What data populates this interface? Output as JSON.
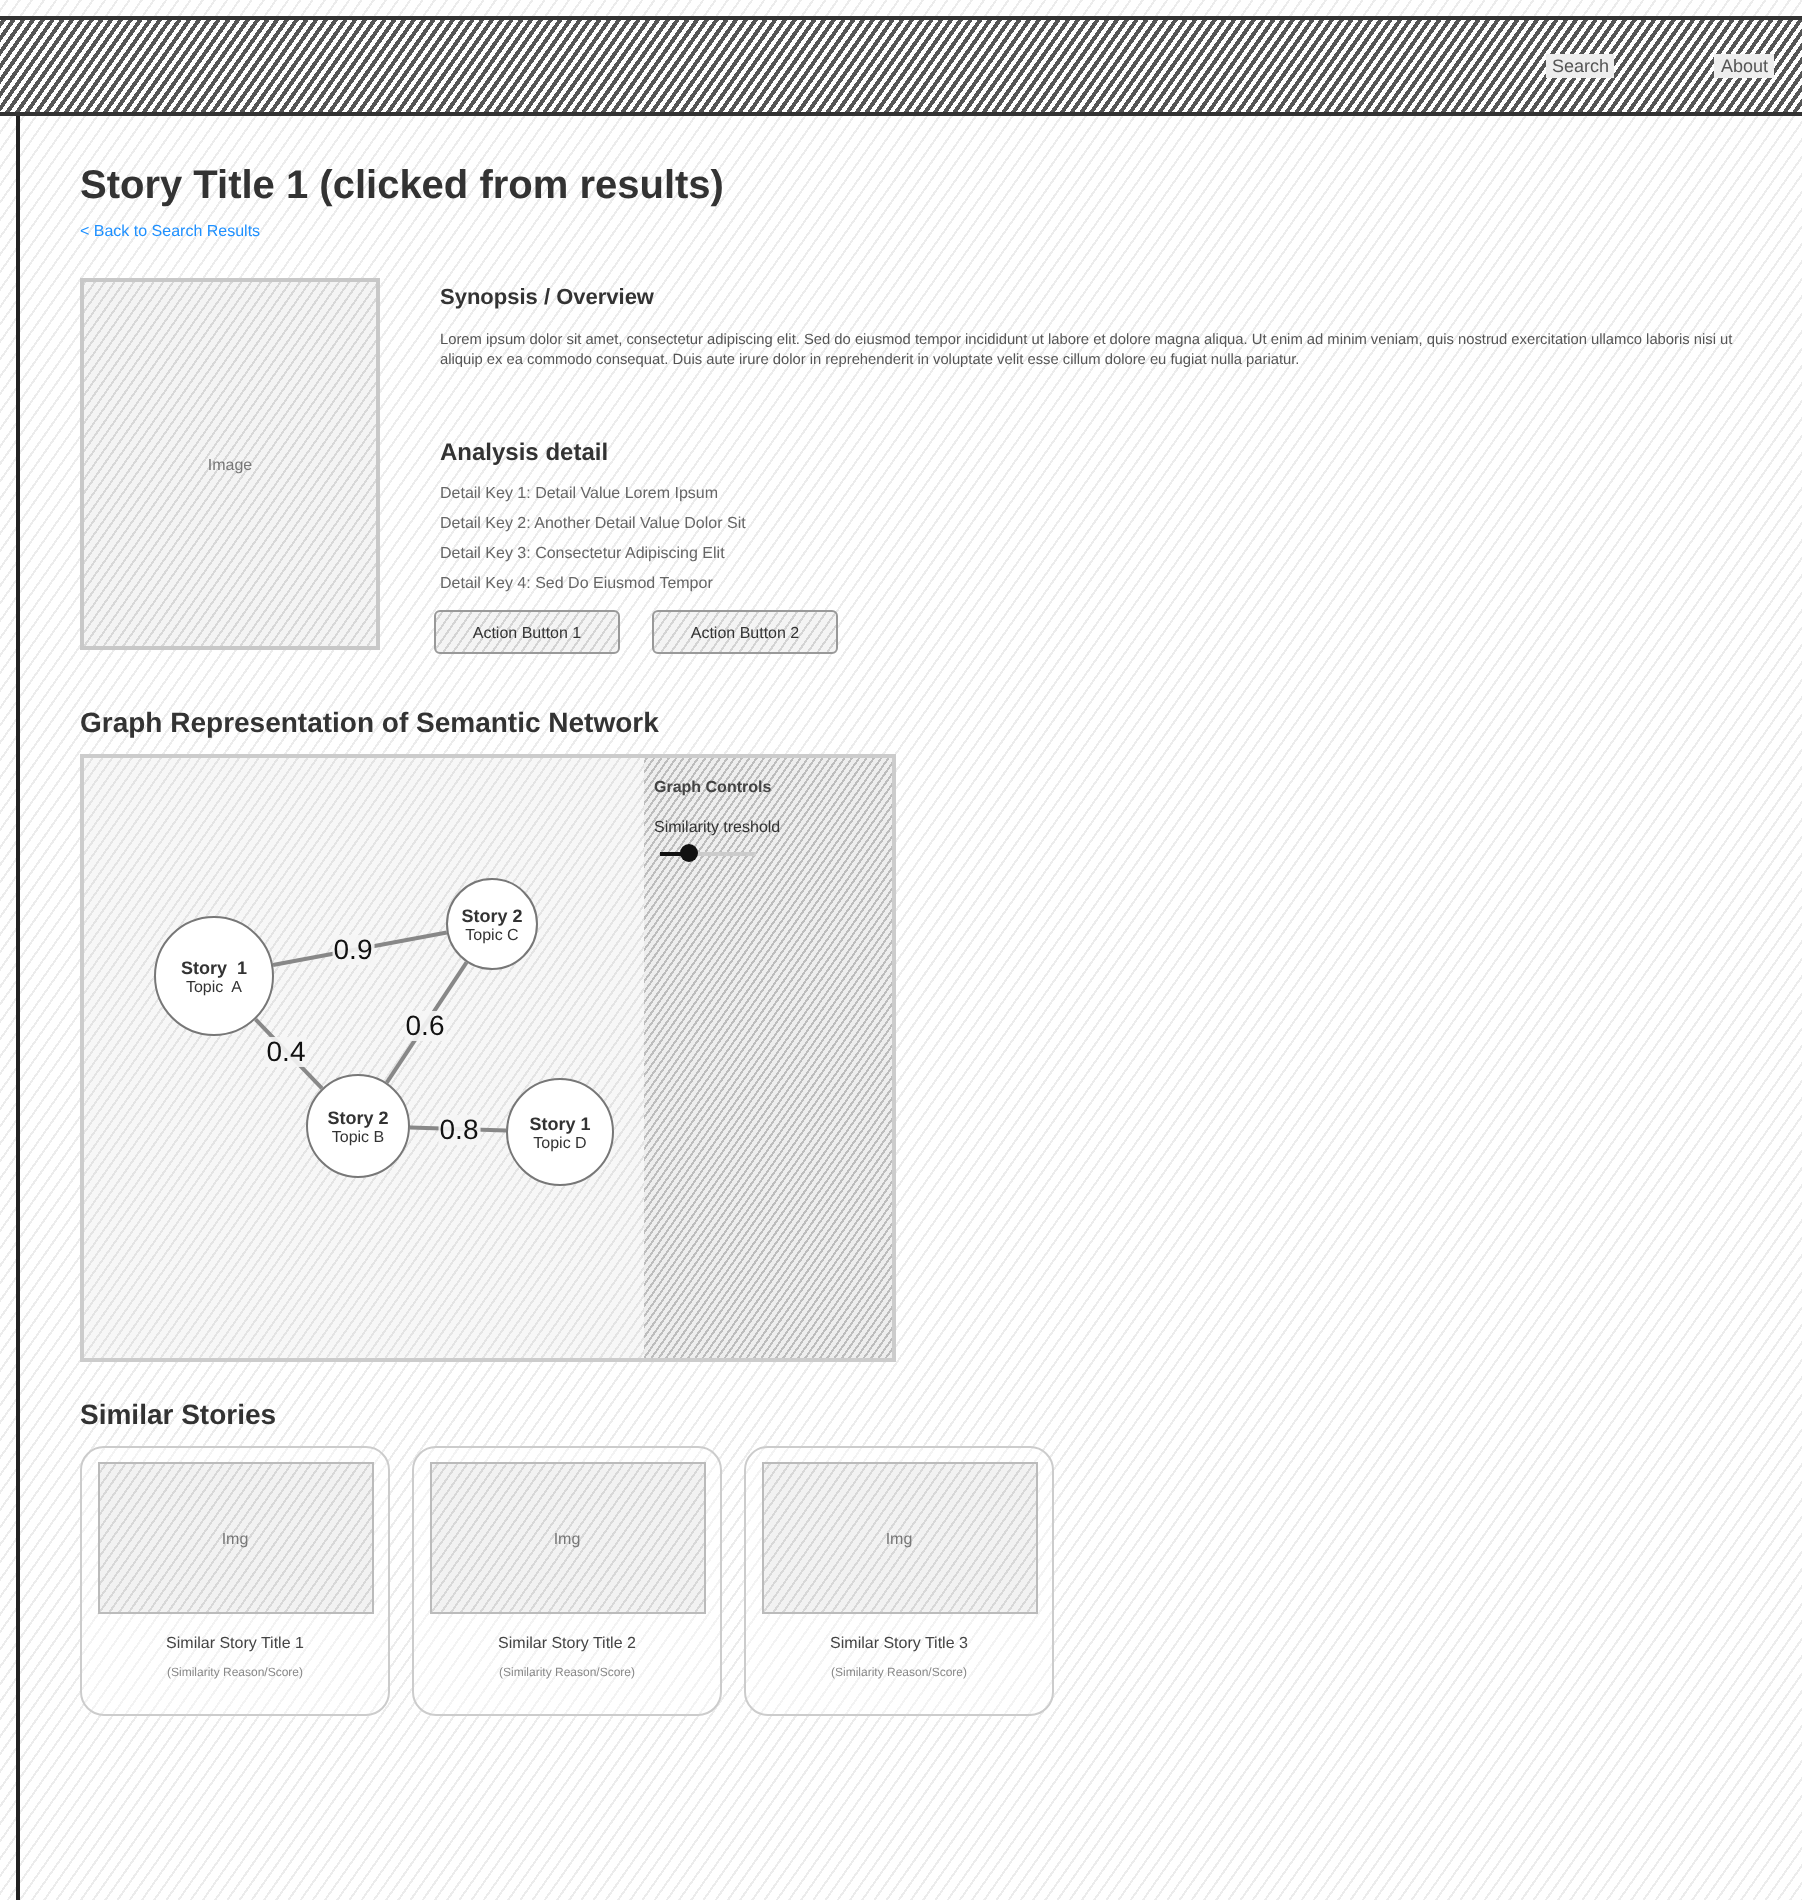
{
  "nav": {
    "links": [
      {
        "label": "Search"
      },
      {
        "label": "About"
      }
    ]
  },
  "story": {
    "title": "Story Title 1 (clicked from results)",
    "back_link": "< Back to Search Results",
    "image_label": "Image",
    "synopsis_heading": "Synopsis / Overview",
    "synopsis": "Lorem ipsum dolor sit amet, consectetur adipiscing elit. Sed do eiusmod tempor incididunt ut labore et dolore magna aliqua. Ut enim ad minim veniam, quis nostrud exercitation ullamco laboris nisi ut aliquip ex ea commodo consequat. Duis aute irure dolor in reprehenderit in voluptate velit esse cillum dolore eu fugiat nulla pariatur.",
    "analysis_heading": "Analysis detail",
    "details": [
      "Detail Key 1: Detail Value Lorem Ipsum",
      "Detail Key 2: Another Detail Value Dolor Sit",
      "Detail Key 3: Consectetur Adipiscing Elit",
      "Detail Key 4: Sed Do Eiusmod Tempor"
    ],
    "buttons": [
      "Action Button 1",
      "Action Button 2"
    ]
  },
  "graph": {
    "heading": "Graph Representation of Semantic Network",
    "nodes": [
      {
        "title": "Story  1",
        "topic": "Topic  A"
      },
      {
        "title": "Story 2",
        "topic": "Topic C"
      },
      {
        "title": "Story 2",
        "topic": "Topic B"
      },
      {
        "title": "Story 1",
        "topic": "Topic D"
      }
    ],
    "edges": [
      {
        "label": "0.9"
      },
      {
        "label": "0.6"
      },
      {
        "label": "0.4"
      },
      {
        "label": "0.8"
      }
    ],
    "controls": {
      "title": "Graph Controls",
      "slider_label": "Similarity treshold",
      "level": 0.3
    }
  },
  "similar": {
    "heading": "Similar Stories",
    "cards": [
      {
        "image_label": "Img",
        "title": "Similar Story Title 1",
        "reason": "(Similarity Reason/Score)"
      },
      {
        "image_label": "Img",
        "title": "Similar Story Title 2",
        "reason": "(Similarity Reason/Score)"
      },
      {
        "image_label": "Img",
        "title": "Similar Story Title 3",
        "reason": "(Similarity Reason/Score)"
      }
    ]
  }
}
